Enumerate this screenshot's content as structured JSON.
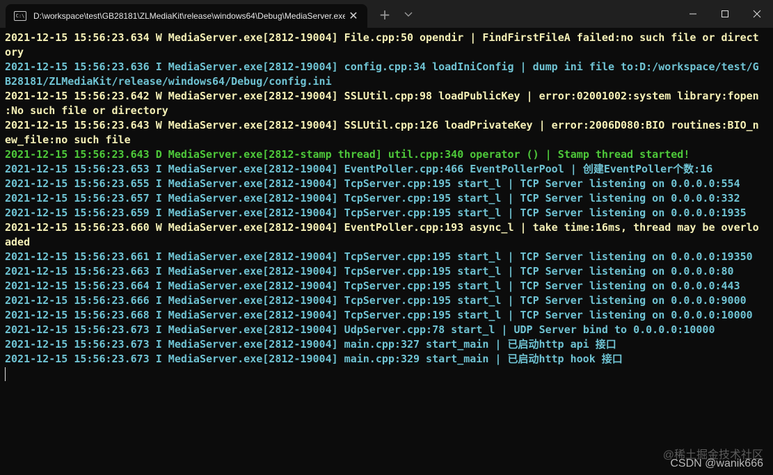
{
  "window": {
    "tab_title": "D:\\workspace\\test\\GB28181\\ZLMediaKit\\release\\windows64\\Debug\\MediaServer.exe",
    "tab_icon_glyph": "C:\\",
    "close_tab_glyph": "✕",
    "new_tab_glyph": "+"
  },
  "terminal": {
    "lines": [
      {
        "level": "w",
        "text": "2021-12-15 15:56:23.634 W MediaServer.exe[2812-19004] File.cpp:50 opendir | FindFirstFileA failed:no such file or direct"
      },
      {
        "level": "w",
        "text": "ory"
      },
      {
        "level": "i",
        "text": "2021-12-15 15:56:23.636 I MediaServer.exe[2812-19004] config.cpp:34 loadIniConfig | dump ini file to:D:/workspace/test/G"
      },
      {
        "level": "i",
        "text": "B28181/ZLMediaKit/release/windows64/Debug/config.ini"
      },
      {
        "level": "w",
        "text": "2021-12-15 15:56:23.642 W MediaServer.exe[2812-19004] SSLUtil.cpp:98 loadPublicKey | error:02001002:system library:fopen"
      },
      {
        "level": "w",
        "text": ":No such file or directory"
      },
      {
        "level": "w",
        "text": "2021-12-15 15:56:23.643 W MediaServer.exe[2812-19004] SSLUtil.cpp:126 loadPrivateKey | error:2006D080:BIO routines:BIO_n"
      },
      {
        "level": "w",
        "text": "ew_file:no such file"
      },
      {
        "level": "d",
        "text": "2021-12-15 15:56:23.643 D MediaServer.exe[2812-stamp thread] util.cpp:340 operator () | Stamp thread started!"
      },
      {
        "level": "i",
        "text": "2021-12-15 15:56:23.653 I MediaServer.exe[2812-19004] EventPoller.cpp:466 EventPollerPool | 创建EventPoller个数:16"
      },
      {
        "level": "i",
        "text": "2021-12-15 15:56:23.655 I MediaServer.exe[2812-19004] TcpServer.cpp:195 start_l | TCP Server listening on 0.0.0.0:554"
      },
      {
        "level": "i",
        "text": "2021-12-15 15:56:23.657 I MediaServer.exe[2812-19004] TcpServer.cpp:195 start_l | TCP Server listening on 0.0.0.0:332"
      },
      {
        "level": "i",
        "text": "2021-12-15 15:56:23.659 I MediaServer.exe[2812-19004] TcpServer.cpp:195 start_l | TCP Server listening on 0.0.0.0:1935"
      },
      {
        "level": "w",
        "text": "2021-12-15 15:56:23.660 W MediaServer.exe[2812-19004] EventPoller.cpp:193 async_l | take time:16ms, thread may be overlo"
      },
      {
        "level": "w",
        "text": "aded"
      },
      {
        "level": "i",
        "text": "2021-12-15 15:56:23.661 I MediaServer.exe[2812-19004] TcpServer.cpp:195 start_l | TCP Server listening on 0.0.0.0:19350"
      },
      {
        "level": "i",
        "text": "2021-12-15 15:56:23.663 I MediaServer.exe[2812-19004] TcpServer.cpp:195 start_l | TCP Server listening on 0.0.0.0:80"
      },
      {
        "level": "i",
        "text": "2021-12-15 15:56:23.664 I MediaServer.exe[2812-19004] TcpServer.cpp:195 start_l | TCP Server listening on 0.0.0.0:443"
      },
      {
        "level": "i",
        "text": "2021-12-15 15:56:23.666 I MediaServer.exe[2812-19004] TcpServer.cpp:195 start_l | TCP Server listening on 0.0.0.0:9000"
      },
      {
        "level": "i",
        "text": "2021-12-15 15:56:23.668 I MediaServer.exe[2812-19004] TcpServer.cpp:195 start_l | TCP Server listening on 0.0.0.0:10000"
      },
      {
        "level": "i",
        "text": "2021-12-15 15:56:23.673 I MediaServer.exe[2812-19004] UdpServer.cpp:78 start_l | UDP Server bind to 0.0.0.0:10000"
      },
      {
        "level": "i",
        "text": "2021-12-15 15:56:23.673 I MediaServer.exe[2812-19004] main.cpp:327 start_main | 已启动http api 接口"
      },
      {
        "level": "i",
        "text": "2021-12-15 15:56:23.673 I MediaServer.exe[2812-19004] main.cpp:329 start_main | 已启动http hook 接口"
      }
    ]
  },
  "watermark": {
    "line1": "@稀土掘金技术社区",
    "line2": "CSDN @wanik666"
  },
  "colors": {
    "warn": "#f5f0b6",
    "info": "#6fc3d3",
    "debug": "#4ec93a",
    "background": "#0c0c0c",
    "titlebar": "#202020"
  }
}
